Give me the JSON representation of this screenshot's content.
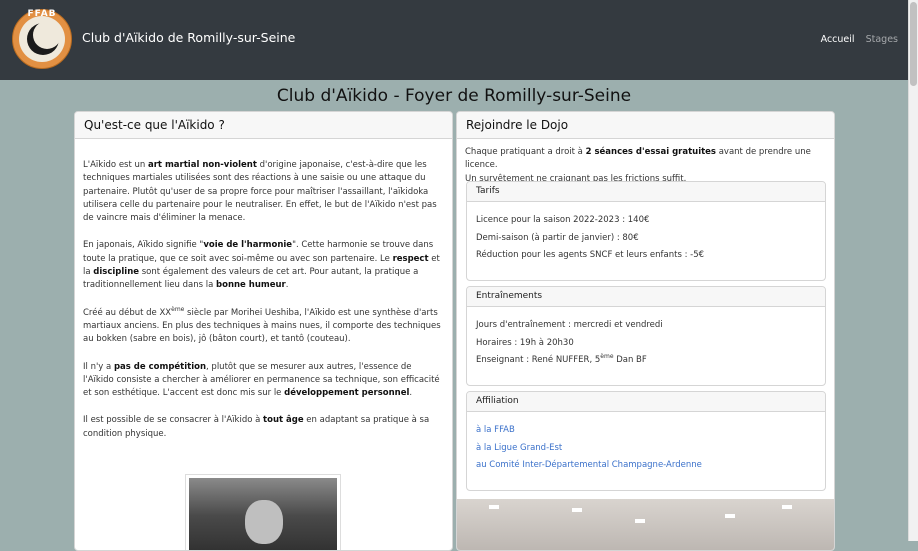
{
  "nav": {
    "brand": "Club d'Aïkido de Romilly-sur-Seine",
    "logo_text": "FFAB",
    "links": [
      {
        "label": "Accueil",
        "active": true
      },
      {
        "label": "Stages",
        "active": false
      }
    ]
  },
  "page_title": "Club d'Aïkido - Foyer de Romilly-sur-Seine",
  "left_card": {
    "title": "Qu'est-ce que l'Aïkido ?",
    "p1": {
      "a": "L'Aïkido est un ",
      "b": "art martial non-violent",
      "c": " d'origine japonaise, c'est-à-dire que les techniques martiales utilisées sont des réactions à une saisie ou une attaque du partenaire. Plutôt qu'user de sa propre force pour maîtriser l'assaillant, l'aïkidoka utilisera celle du partenaire pour le neutraliser. En effet, le but de l'Aïkido n'est pas de vaincre mais d'éliminer la menace."
    },
    "p2": {
      "a": "En japonais, Aïkido signifie \"",
      "b": "voie de l'harmonie",
      "c": "\". Cette harmonie se trouve dans toute la pratique, que ce soit avec soi-même ou avec son partenaire. Le ",
      "d": "respect",
      "e": " et la ",
      "f": "discipline",
      "g": " sont également des valeurs de cet art. Pour autant, la pratique a traditionnellement lieu dans la ",
      "h": "bonne humeur",
      "i": "."
    },
    "p3": {
      "a": "Créé au début de XX",
      "sup": "ème",
      "b": " siècle par Morihei Ueshiba, l'Aïkido est une synthèse d'arts martiaux anciens. En plus des techniques à mains nues, il comporte des techniques au bokken (sabre en bois), jô (bâton court), et tantô (couteau)."
    },
    "p4": {
      "a": "Il n'y a ",
      "b": "pas de compétition",
      "c": ", plutôt que se mesurer aux autres, l'essence de l'Aïkido consiste a chercher à améliorer en permanence sa technique, son efficacité et son esthétique. L'accent est donc mis sur le ",
      "d": "développement personnel",
      "e": "."
    },
    "p5": {
      "a": "Il est possible de se consacrer à l'Aïkido à ",
      "b": "tout âge",
      "c": " en adaptant sa pratique à sa condition physique."
    }
  },
  "right_card": {
    "title": "Rejoindre le Dojo",
    "intro": {
      "a": "Chaque pratiquant a droit à ",
      "b": "2 séances d'essai gratuites",
      "c": " avant de prendre une licence.",
      "line2": "Un survêtement ne craignant pas les frictions suffit."
    },
    "tarifs": {
      "title": "Tarifs",
      "lines": [
        "Licence pour la saison 2022-2023 : 140€",
        "Demi-saison (à partir de janvier) : 80€",
        "Réduction pour les agents SNCF et leurs enfants : -5€"
      ]
    },
    "entrainements": {
      "title": "Entraînements",
      "days": "Jours d'entraînement : mercredi et vendredi",
      "hours": "Horaires : 19h à 20h30",
      "teacher_a": "Enseignant : René NUFFER, 5",
      "teacher_sup": "ème",
      "teacher_b": " Dan BF"
    },
    "affiliation": {
      "title": "Affiliation",
      "links": [
        "à la FFAB",
        "à la Ligue Grand-Est",
        "au Comité Inter-Départemental Champagne-Ardenne"
      ]
    }
  }
}
